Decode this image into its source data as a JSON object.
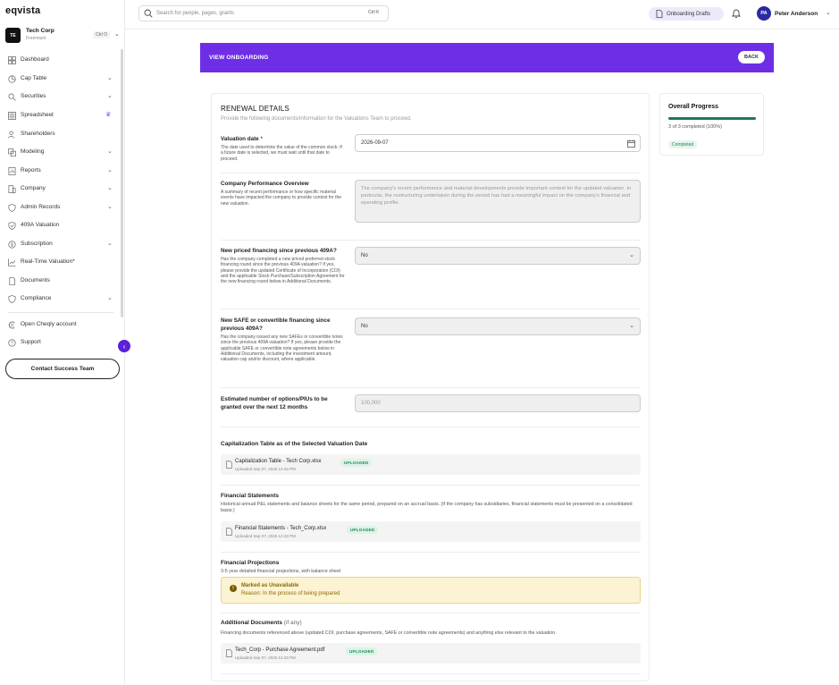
{
  "app": {
    "logo": "eqvista"
  },
  "company": {
    "initials": "TE",
    "name": "Tech Corp",
    "plan": "Freemium",
    "shortcut": "Ctrl O"
  },
  "sidebar": {
    "items": [
      {
        "label": "Dashboard",
        "icon": "dashboard-icon",
        "chevron": false
      },
      {
        "label": "Cap Table",
        "icon": "pie-chart-icon",
        "chevron": true
      },
      {
        "label": "Securities",
        "icon": "securities-icon",
        "chevron": true
      },
      {
        "label": "Spreadsheet",
        "icon": "grid-icon",
        "chevron": false,
        "crown": true
      },
      {
        "label": "Shareholders",
        "icon": "users-icon",
        "chevron": false
      },
      {
        "label": "Modeling",
        "icon": "modeling-icon",
        "chevron": true
      },
      {
        "label": "Reports",
        "icon": "report-icon",
        "chevron": true
      },
      {
        "label": "Company",
        "icon": "building-icon",
        "chevron": true
      },
      {
        "label": "Admin Records",
        "icon": "shield-icon",
        "chevron": true
      },
      {
        "label": "409A Valuation",
        "icon": "check-shield-icon",
        "chevron": false
      },
      {
        "label": "Subscription",
        "icon": "dollar-icon",
        "chevron": true
      },
      {
        "label": "Real-Time Valuation*",
        "icon": "trend-icon",
        "chevron": false
      },
      {
        "label": "Documents",
        "icon": "document-icon",
        "chevron": false
      },
      {
        "label": "Compliance",
        "icon": "compliance-icon",
        "chevron": true
      }
    ],
    "bottom": [
      {
        "label": "Open Cheqly account",
        "icon": "cheqly-icon"
      },
      {
        "label": "Support",
        "icon": "help-icon"
      }
    ],
    "contact_label": "Contact Success Team"
  },
  "header": {
    "search_placeholder": "Search for people, pages, grants",
    "search_shortcut": "Ctrl K",
    "drafts_label": "Onboarding Drafts",
    "user_initials": "PA",
    "user_name": "Peter Anderson"
  },
  "banner": {
    "title": "VIEW ONBOARDING",
    "back_label": "BACK"
  },
  "form": {
    "title": "RENEWAL DETAILS",
    "subtitle": "Provide the following documents/information for the Valuations Team to proceed.",
    "valuation_date": {
      "label": "Valuation date",
      "required_mark": "*",
      "desc": "The date used to determine the value of the common stock. If a future date is selected, we must wait until that date to proceed.",
      "value": "2026-09-07"
    },
    "performance": {
      "label": "Company Performance Overview",
      "desc": "A summary of recent performance or how specific material events have impacted the company to provide context for the new valuation.",
      "placeholder": "The company's recent performance and material developments provide important context for the updated valuation. In particular, the restructuring undertaken during the period has had a meaningful impact on the company's financial and operating profile."
    },
    "priced_financing": {
      "label": "New priced financing since previous 409A?",
      "desc": "Has the company completed a new priced preferred stock financing round since the previous 409A valuation? If yes, please provide the updated Certificate of Incorporation (COI) and the applicable Stock Purchase/Subscription Agreement for the new financing round below in Additional Documents.",
      "value": "No"
    },
    "safe_financing": {
      "label": "New SAFE or convertible financing since previous 409A?",
      "desc": "Has the company issued any new SAFEs or convertible notes since the previous 409A valuation? If yes, please provide the applicable SAFE or convertible note agreements below in Additional Documents, including the investment amount, valuation cap and/or discount, where applicable.",
      "value": "No"
    },
    "options": {
      "label": "Estimated number of options/PIUs to be granted over the next 12 months",
      "placeholder": "100,000"
    },
    "cap_table": {
      "title": "Capitalization Table as of the Selected Valuation Date",
      "file": "Capitalization Table - Tech Corp.xlsx",
      "badge": "UPLOADED",
      "meta": "Uploaded Sep 07, 2026 12:43 PM"
    },
    "financial_statements": {
      "title": "Financial Statements",
      "desc": "Historical annual P&L statements and balance sheets for the same period, prepared on an accrual basis. (If the company has subsidiaries, financial statements must be presented on a consolidated basis.)",
      "file": "Financial Statements - Tech_Corp.xlsx",
      "badge": "UPLOADED",
      "meta": "Uploaded Sep 07, 2026 12:43 PM"
    },
    "projections": {
      "title": "Financial Projections",
      "desc": "3-5 year detailed financial projections, with balance sheet",
      "unavailable_title": "Marked as Unavailable",
      "unavailable_reason": "Reason: In the process of being prepared"
    },
    "additional": {
      "title": "Additional Documents",
      "title_suffix": "(if any)",
      "desc": "Financing documents referenced above (updated COI, purchase agreements, SAFE or convertible note agreements) and anything else relevant to the valuation.",
      "file": "Tech_Corp - Purchase Agreement.pdf",
      "badge": "UPLOADED",
      "meta": "Uploaded Sep 07, 2026 12:43 PM"
    }
  },
  "progress": {
    "title": "Overall Progress",
    "text": "3 of 3 completed (100%)",
    "percent": 100,
    "badge": "Completed"
  }
}
